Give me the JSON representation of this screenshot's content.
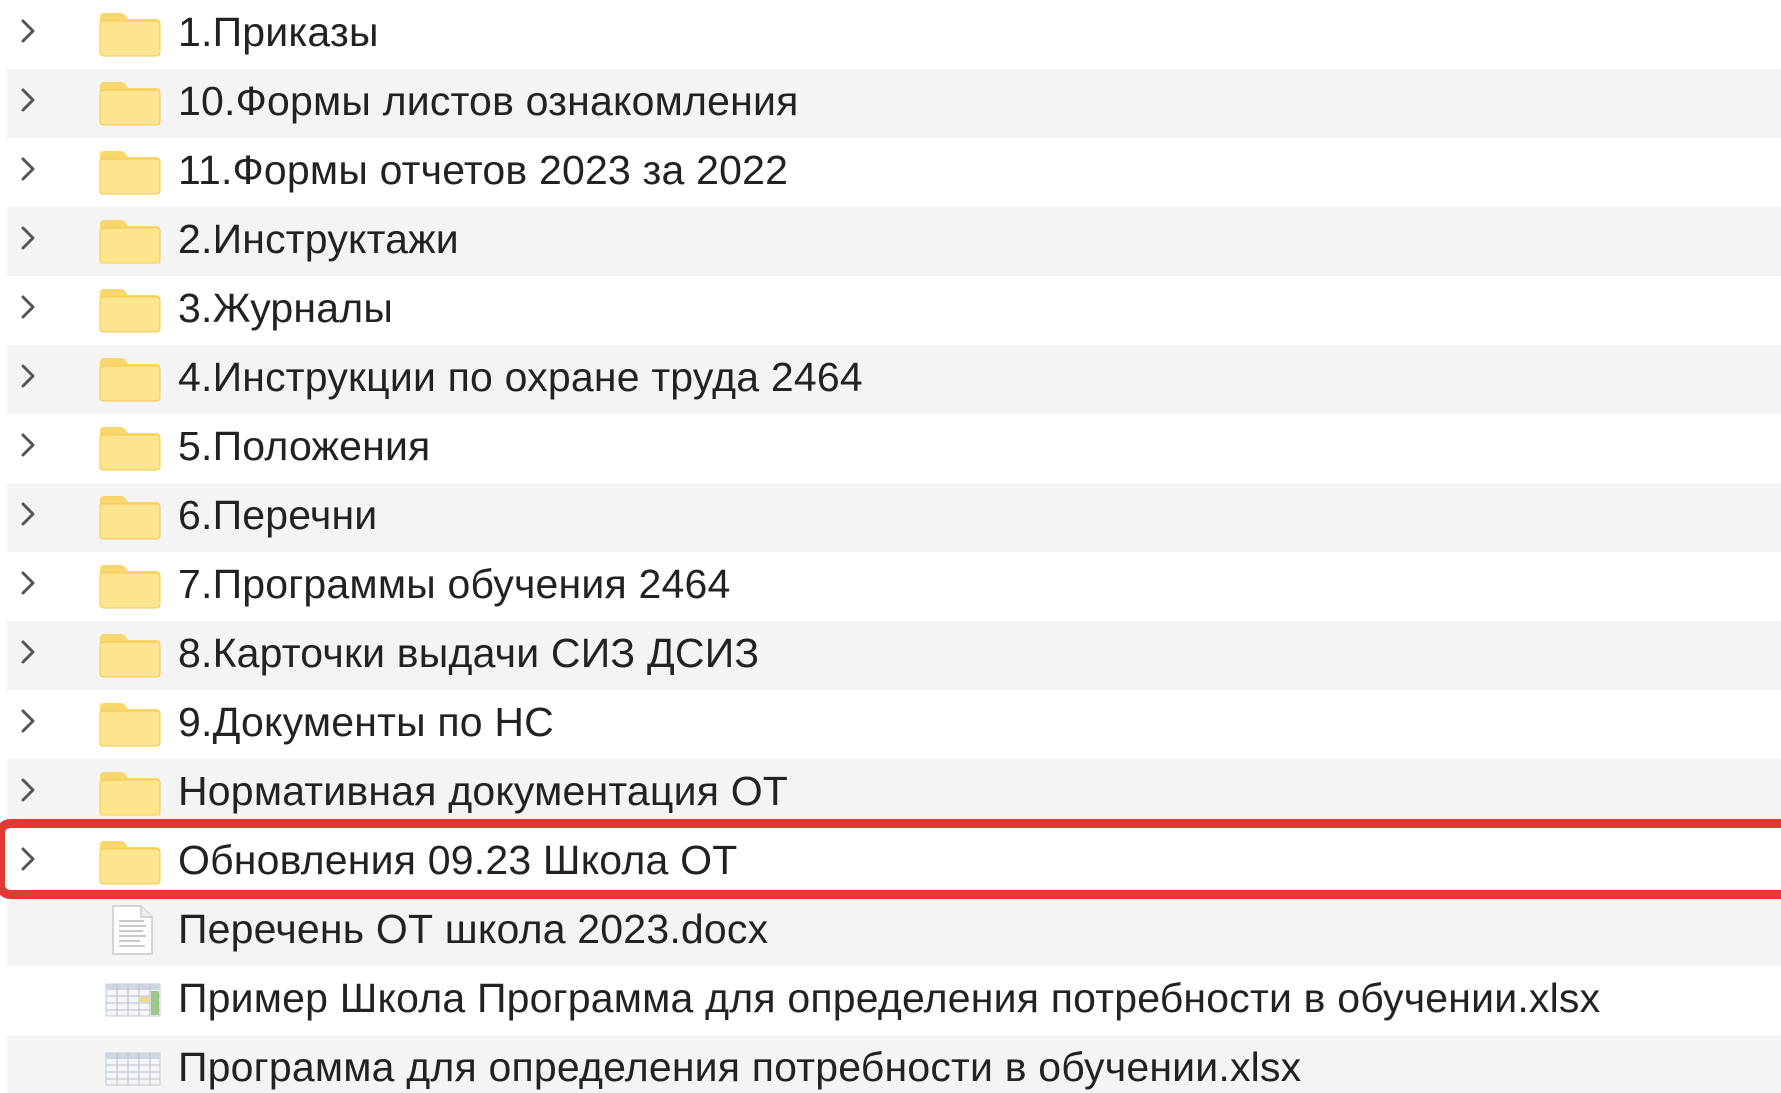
{
  "items": [
    {
      "name": "1.Приказы",
      "type": "folder",
      "icon": "folder-icon"
    },
    {
      "name": "10.Формы листов ознакомления",
      "type": "folder",
      "icon": "folder-icon"
    },
    {
      "name": "11.Формы отчетов 2023 за 2022",
      "type": "folder",
      "icon": "folder-icon"
    },
    {
      "name": "2.Инструктажи",
      "type": "folder",
      "icon": "folder-icon"
    },
    {
      "name": "3.Журналы",
      "type": "folder",
      "icon": "folder-icon"
    },
    {
      "name": "4.Инструкции по охране труда 2464",
      "type": "folder",
      "icon": "folder-icon"
    },
    {
      "name": "5.Положения",
      "type": "folder",
      "icon": "folder-icon"
    },
    {
      "name": "6.Перечни",
      "type": "folder",
      "icon": "folder-icon"
    },
    {
      "name": "7.Программы обучения 2464",
      "type": "folder",
      "icon": "folder-icon"
    },
    {
      "name": "8.Карточки выдачи СИЗ ДСИЗ",
      "type": "folder",
      "icon": "folder-icon"
    },
    {
      "name": "9.Документы по НС",
      "type": "folder",
      "icon": "folder-icon"
    },
    {
      "name": "Нормативная документация ОТ",
      "type": "folder",
      "icon": "folder-icon"
    },
    {
      "name": "Обновления 09.23 Школа ОТ",
      "type": "folder",
      "icon": "folder-icon",
      "highlighted": true
    },
    {
      "name": "Перечень ОТ школа 2023.docx",
      "type": "file",
      "icon": "docx-file-icon"
    },
    {
      "name": "Пример Школа Программа для определения потребности в обучении.xlsx",
      "type": "file",
      "icon": "xlsx-file-icon"
    },
    {
      "name": "Программа для определения потребности в обучении.xlsx",
      "type": "file",
      "icon": "xlsx-file-icon"
    }
  ],
  "colors": {
    "row_alt": "#f4f4f5",
    "highlight": "#e23a30",
    "folder_fill": "#fde58f",
    "folder_tab": "#f9d66e"
  }
}
